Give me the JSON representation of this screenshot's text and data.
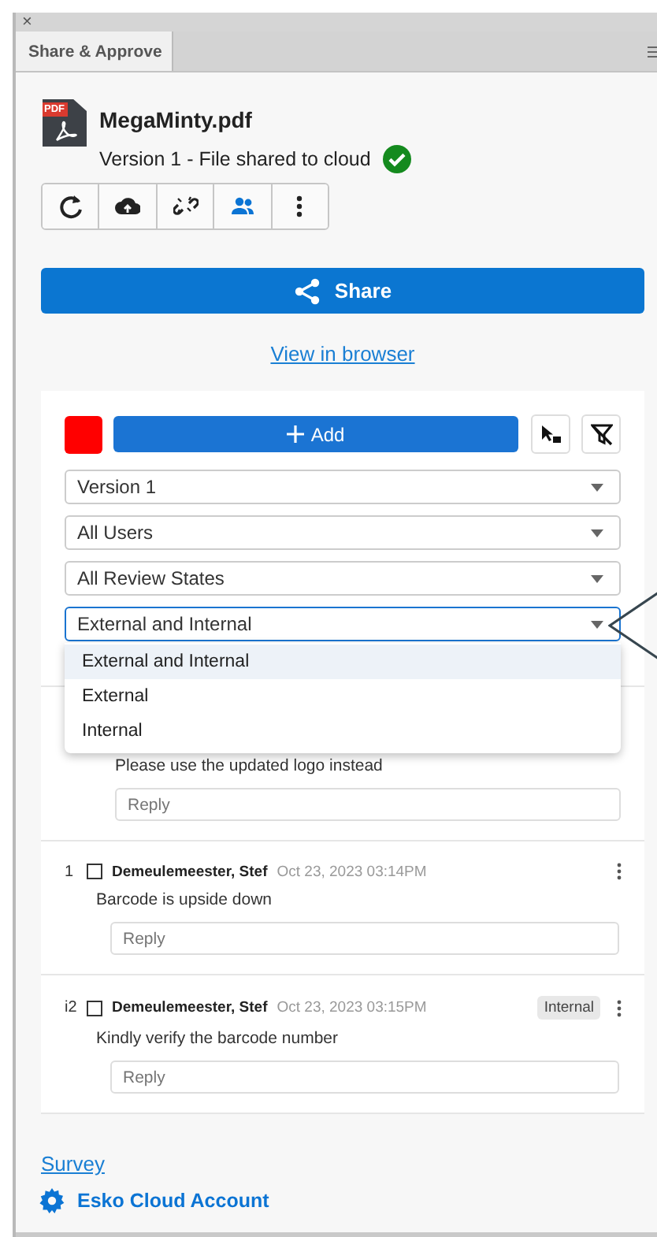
{
  "panel": {
    "close": "×",
    "tab": {
      "label": "Share & Approve",
      "selected": true
    }
  },
  "file": {
    "name": "MegaMinty.pdf",
    "icon_label": "PDF",
    "status": "Version 1 - File shared to cloud",
    "shared": true
  },
  "toolbar": [
    {
      "active": false
    },
    {
      "active": false
    },
    {
      "active": false
    },
    {
      "active": true
    },
    {
      "active": false
    }
  ],
  "share_button": "Share",
  "view_link": "View in browser",
  "annotations": {
    "color": "#ff0000",
    "add_button": "Add",
    "filters": [
      {
        "value": "Version 1",
        "open": false
      },
      {
        "value": "All Users",
        "open": false
      },
      {
        "value": "All Review States",
        "open": false
      },
      {
        "value": "External and Internal",
        "open": true,
        "options": [
          {
            "label": "External and Internal",
            "selected": true
          },
          {
            "label": "External",
            "selected": false
          },
          {
            "label": "Internal",
            "selected": false
          }
        ]
      }
    ],
    "comments": [
      {
        "body": "Please use the updated logo instead",
        "reply_placeholder": "Reply"
      },
      {
        "number": "1",
        "checked": false,
        "author": "Demeulemeester, Stef",
        "date": "Oct 23, 2023 03:14PM",
        "body": "Barcode is upside down",
        "reply_placeholder": "Reply"
      },
      {
        "number": "i2",
        "checked": false,
        "author": "Demeulemeester, Stef",
        "date": "Oct 23, 2023 03:15PM",
        "tag": "Internal",
        "body": "Kindly verify the barcode number",
        "reply_placeholder": "Reply"
      }
    ]
  },
  "footer": {
    "survey_link": "Survey",
    "account_link": "Esko Cloud Account"
  }
}
